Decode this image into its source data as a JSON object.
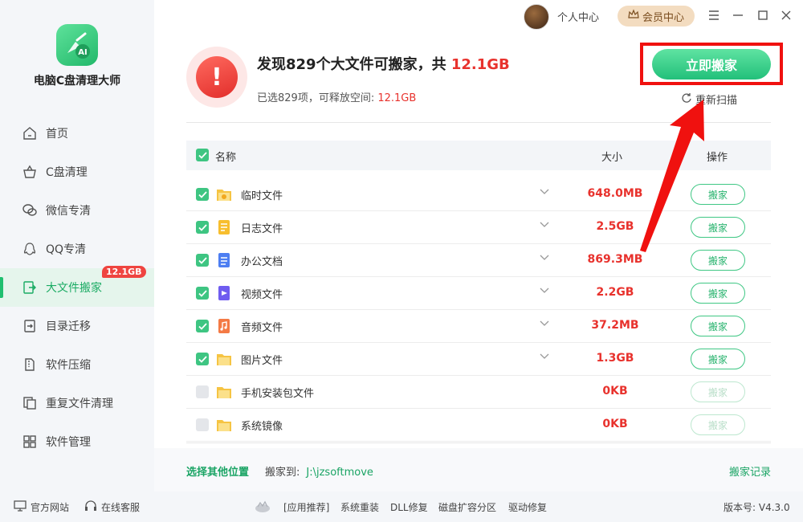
{
  "app": {
    "title": "电脑C盘清理大师"
  },
  "topbar": {
    "user_center": "个人中心",
    "vip_center": "会员中心"
  },
  "sidebar": {
    "items": [
      {
        "label": "首页",
        "icon": "home-icon"
      },
      {
        "label": "C盘清理",
        "icon": "basket-icon"
      },
      {
        "label": "微信专清",
        "icon": "wechat-icon"
      },
      {
        "label": "QQ专清",
        "icon": "qq-icon"
      },
      {
        "label": "大文件搬家",
        "icon": "file-move-icon",
        "badge": "12.1GB",
        "active": true
      },
      {
        "label": "目录迁移",
        "icon": "migrate-icon"
      },
      {
        "label": "软件压缩",
        "icon": "zip-icon"
      },
      {
        "label": "重复文件清理",
        "icon": "duplicate-icon"
      },
      {
        "label": "软件管理",
        "icon": "apps-icon"
      }
    ]
  },
  "summary": {
    "headline_prefix": "发现829个大文件可搬家，共 ",
    "headline_total": "12.1GB",
    "subline_prefix": "已选829项，可释放空间: ",
    "subline_value": "12.1GB",
    "move_now": "立即搬家",
    "rescan": "重新扫描"
  },
  "table": {
    "headers": {
      "name": "名称",
      "size": "大小",
      "action": "操作"
    },
    "rows": [
      {
        "name": "临时文件",
        "size": "648.0MB",
        "checked": true,
        "icon": "temp-file-icon",
        "action": "搬家",
        "enabled": true
      },
      {
        "name": "日志文件",
        "size": "2.5GB",
        "checked": true,
        "icon": "log-file-icon",
        "action": "搬家",
        "enabled": true
      },
      {
        "name": "办公文档",
        "size": "869.3MB",
        "checked": true,
        "icon": "document-icon",
        "action": "搬家",
        "enabled": true
      },
      {
        "name": "视频文件",
        "size": "2.2GB",
        "checked": true,
        "icon": "video-file-icon",
        "action": "搬家",
        "enabled": true
      },
      {
        "name": "音频文件",
        "size": "37.2MB",
        "checked": true,
        "icon": "audio-file-icon",
        "action": "搬家",
        "enabled": true
      },
      {
        "name": "图片文件",
        "size": "1.3GB",
        "checked": true,
        "icon": "image-folder-icon",
        "action": "搬家",
        "enabled": true
      },
      {
        "name": "手机安装包文件",
        "size": "0KB",
        "checked": false,
        "icon": "apk-folder-icon",
        "action": "搬家",
        "enabled": false
      },
      {
        "name": "系统镜像",
        "size": "0KB",
        "checked": false,
        "icon": "image-iso-folder-icon",
        "action": "搬家",
        "enabled": false
      }
    ]
  },
  "footer": {
    "other_location": "选择其他位置",
    "move_to_label": "搬家到:",
    "move_to_path": "J:\\jzsoftmove",
    "move_log": "搬家记录"
  },
  "statusbar": {
    "official_site": "官方网站",
    "online_service": "在线客服",
    "recommend": "[应用推荐]",
    "links": [
      "系统重装",
      "DLL修复",
      "磁盘扩容分区",
      "驱动修复"
    ],
    "version": "版本号: V4.3.0"
  },
  "colors": {
    "accent": "#22c07a",
    "danger": "#e8322d",
    "annotation": "#f0110f"
  }
}
